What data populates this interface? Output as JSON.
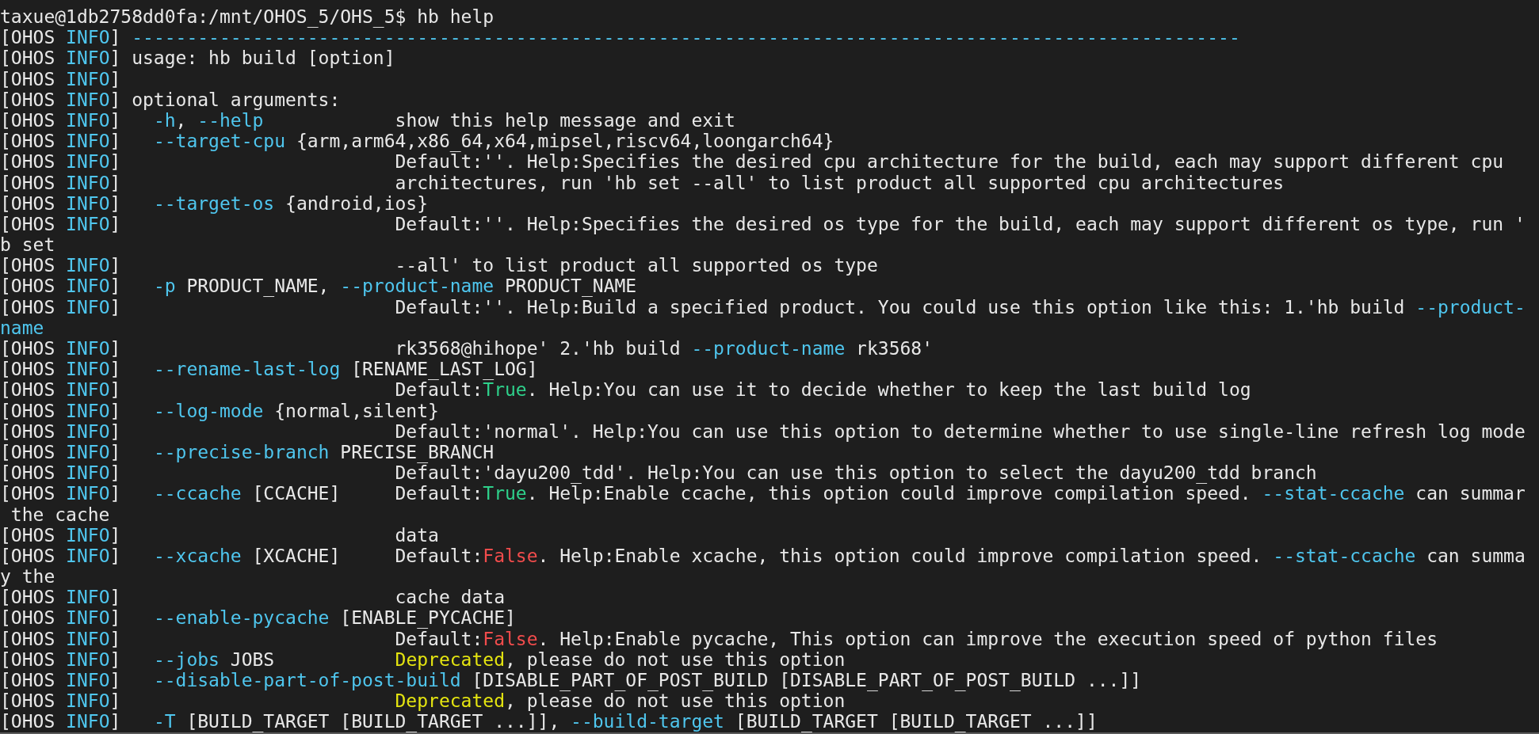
{
  "terminal": {
    "lines": [
      {
        "segments": [
          {
            "text": "taxue@1db2758dd0fa:/mnt/OHOS_5/OHS_5$ hb help",
            "kind": "plain"
          }
        ]
      },
      {
        "segments": [
          {
            "text": "[OHOS ",
            "kind": "plain"
          },
          {
            "text": "INFO",
            "kind": "info"
          },
          {
            "text": "] ",
            "kind": "plain"
          },
          {
            "text": "-----------------------------------------------------------------------------------------------------",
            "kind": "option"
          }
        ]
      },
      {
        "segments": [
          {
            "text": "[OHOS ",
            "kind": "plain"
          },
          {
            "text": "INFO",
            "kind": "info"
          },
          {
            "text": "] usage: hb build [option]",
            "kind": "plain"
          }
        ]
      },
      {
        "segments": [
          {
            "text": "[OHOS ",
            "kind": "plain"
          },
          {
            "text": "INFO",
            "kind": "info"
          },
          {
            "text": "]",
            "kind": "plain"
          }
        ]
      },
      {
        "segments": [
          {
            "text": "[OHOS ",
            "kind": "plain"
          },
          {
            "text": "INFO",
            "kind": "info"
          },
          {
            "text": "] optional arguments:",
            "kind": "plain"
          }
        ]
      },
      {
        "segments": [
          {
            "text": "[OHOS ",
            "kind": "plain"
          },
          {
            "text": "INFO",
            "kind": "info"
          },
          {
            "text": "]   ",
            "kind": "plain"
          },
          {
            "text": "-h",
            "kind": "option"
          },
          {
            "text": ", ",
            "kind": "plain"
          },
          {
            "text": "--help",
            "kind": "option"
          },
          {
            "text": "            show this help message and exit",
            "kind": "plain"
          }
        ]
      },
      {
        "segments": [
          {
            "text": "[OHOS ",
            "kind": "plain"
          },
          {
            "text": "INFO",
            "kind": "info"
          },
          {
            "text": "]   ",
            "kind": "plain"
          },
          {
            "text": "--target-cpu",
            "kind": "option"
          },
          {
            "text": " {arm,arm64,x86_64,x64,mipsel,riscv64,loongarch64}",
            "kind": "plain"
          }
        ]
      },
      {
        "segments": [
          {
            "text": "[OHOS ",
            "kind": "plain"
          },
          {
            "text": "INFO",
            "kind": "info"
          },
          {
            "text": "]                         Default:''. Help:Specifies the desired cpu architecture for the build, each may support different cpu",
            "kind": "plain"
          }
        ]
      },
      {
        "segments": [
          {
            "text": "[OHOS ",
            "kind": "plain"
          },
          {
            "text": "INFO",
            "kind": "info"
          },
          {
            "text": "]                         architectures, run 'hb set --all' to list product all supported cpu architectures",
            "kind": "plain"
          }
        ]
      },
      {
        "segments": [
          {
            "text": "[OHOS ",
            "kind": "plain"
          },
          {
            "text": "INFO",
            "kind": "info"
          },
          {
            "text": "]   ",
            "kind": "plain"
          },
          {
            "text": "--target-os",
            "kind": "option"
          },
          {
            "text": " {android,ios}",
            "kind": "plain"
          }
        ]
      },
      {
        "segments": [
          {
            "text": "[OHOS ",
            "kind": "plain"
          },
          {
            "text": "INFO",
            "kind": "info"
          },
          {
            "text": "]                         Default:''. Help:Specifies the desired os type for the build, each may support different os type, run '",
            "kind": "plain"
          }
        ]
      },
      {
        "segments": [
          {
            "text": "b set",
            "kind": "plain"
          }
        ]
      },
      {
        "segments": [
          {
            "text": "[OHOS ",
            "kind": "plain"
          },
          {
            "text": "INFO",
            "kind": "info"
          },
          {
            "text": "]                         --all' to list product all supported os type",
            "kind": "plain"
          }
        ]
      },
      {
        "segments": [
          {
            "text": "[OHOS ",
            "kind": "plain"
          },
          {
            "text": "INFO",
            "kind": "info"
          },
          {
            "text": "]   ",
            "kind": "plain"
          },
          {
            "text": "-p",
            "kind": "option"
          },
          {
            "text": " PRODUCT_NAME, ",
            "kind": "plain"
          },
          {
            "text": "--product-name",
            "kind": "option"
          },
          {
            "text": " PRODUCT_NAME",
            "kind": "plain"
          }
        ]
      },
      {
        "segments": [
          {
            "text": "[OHOS ",
            "kind": "plain"
          },
          {
            "text": "INFO",
            "kind": "info"
          },
          {
            "text": "]                         Default:''. Help:Build a specified product. You could use this option like this: 1.'hb build ",
            "kind": "plain"
          },
          {
            "text": "--product-",
            "kind": "option"
          }
        ]
      },
      {
        "segments": [
          {
            "text": "name",
            "kind": "option"
          }
        ]
      },
      {
        "segments": [
          {
            "text": "[OHOS ",
            "kind": "plain"
          },
          {
            "text": "INFO",
            "kind": "info"
          },
          {
            "text": "]                         rk3568@hihope' 2.'hb build ",
            "kind": "plain"
          },
          {
            "text": "--product-name",
            "kind": "option"
          },
          {
            "text": " rk3568'",
            "kind": "plain"
          }
        ]
      },
      {
        "segments": [
          {
            "text": "[OHOS ",
            "kind": "plain"
          },
          {
            "text": "INFO",
            "kind": "info"
          },
          {
            "text": "]   ",
            "kind": "plain"
          },
          {
            "text": "--rename-last-log",
            "kind": "option"
          },
          {
            "text": " [RENAME_LAST_LOG]",
            "kind": "plain"
          }
        ]
      },
      {
        "segments": [
          {
            "text": "[OHOS ",
            "kind": "plain"
          },
          {
            "text": "INFO",
            "kind": "info"
          },
          {
            "text": "]                         Default:",
            "kind": "plain"
          },
          {
            "text": "True",
            "kind": "true"
          },
          {
            "text": ". Help:You can use it to decide whether to keep the last build log",
            "kind": "plain"
          }
        ]
      },
      {
        "segments": [
          {
            "text": "[OHOS ",
            "kind": "plain"
          },
          {
            "text": "INFO",
            "kind": "info"
          },
          {
            "text": "]   ",
            "kind": "plain"
          },
          {
            "text": "--log-mode",
            "kind": "option"
          },
          {
            "text": " {normal,silent}",
            "kind": "plain"
          }
        ]
      },
      {
        "segments": [
          {
            "text": "[OHOS ",
            "kind": "plain"
          },
          {
            "text": "INFO",
            "kind": "info"
          },
          {
            "text": "]                         Default:'normal'. Help:You can use this option to determine whether to use single-line refresh log mode",
            "kind": "plain"
          }
        ]
      },
      {
        "segments": [
          {
            "text": "[OHOS ",
            "kind": "plain"
          },
          {
            "text": "INFO",
            "kind": "info"
          },
          {
            "text": "]   ",
            "kind": "plain"
          },
          {
            "text": "--precise-branch",
            "kind": "option"
          },
          {
            "text": " PRECISE_BRANCH",
            "kind": "plain"
          }
        ]
      },
      {
        "segments": [
          {
            "text": "[OHOS ",
            "kind": "plain"
          },
          {
            "text": "INFO",
            "kind": "info"
          },
          {
            "text": "]                         Default:'dayu200_tdd'. Help:You can use this option to select the dayu200_tdd branch",
            "kind": "plain"
          }
        ]
      },
      {
        "segments": [
          {
            "text": "[OHOS ",
            "kind": "plain"
          },
          {
            "text": "INFO",
            "kind": "info"
          },
          {
            "text": "]   ",
            "kind": "plain"
          },
          {
            "text": "--ccache",
            "kind": "option"
          },
          {
            "text": " [CCACHE]     Default:",
            "kind": "plain"
          },
          {
            "text": "True",
            "kind": "true"
          },
          {
            "text": ". Help:Enable ccache, this option could improve compilation speed. ",
            "kind": "plain"
          },
          {
            "text": "--stat-ccache",
            "kind": "option"
          },
          {
            "text": " can summar",
            "kind": "plain"
          }
        ]
      },
      {
        "segments": [
          {
            "text": " the cache",
            "kind": "plain"
          }
        ]
      },
      {
        "segments": [
          {
            "text": "[OHOS ",
            "kind": "plain"
          },
          {
            "text": "INFO",
            "kind": "info"
          },
          {
            "text": "]                         data",
            "kind": "plain"
          }
        ]
      },
      {
        "segments": [
          {
            "text": "[OHOS ",
            "kind": "plain"
          },
          {
            "text": "INFO",
            "kind": "info"
          },
          {
            "text": "]   ",
            "kind": "plain"
          },
          {
            "text": "--xcache",
            "kind": "option"
          },
          {
            "text": " [XCACHE]     Default:",
            "kind": "plain"
          },
          {
            "text": "False",
            "kind": "false"
          },
          {
            "text": ". Help:Enable xcache, this option could improve compilation speed. ",
            "kind": "plain"
          },
          {
            "text": "--stat-ccache",
            "kind": "option"
          },
          {
            "text": " can summa",
            "kind": "plain"
          }
        ]
      },
      {
        "segments": [
          {
            "text": "y the",
            "kind": "plain"
          }
        ]
      },
      {
        "segments": [
          {
            "text": "[OHOS ",
            "kind": "plain"
          },
          {
            "text": "INFO",
            "kind": "info"
          },
          {
            "text": "]                         cache data",
            "kind": "plain"
          }
        ]
      },
      {
        "segments": [
          {
            "text": "[OHOS ",
            "kind": "plain"
          },
          {
            "text": "INFO",
            "kind": "info"
          },
          {
            "text": "]   ",
            "kind": "plain"
          },
          {
            "text": "--enable-pycache",
            "kind": "option"
          },
          {
            "text": " [ENABLE_PYCACHE]",
            "kind": "plain"
          }
        ]
      },
      {
        "segments": [
          {
            "text": "[OHOS ",
            "kind": "plain"
          },
          {
            "text": "INFO",
            "kind": "info"
          },
          {
            "text": "]                         Default:",
            "kind": "plain"
          },
          {
            "text": "False",
            "kind": "false"
          },
          {
            "text": ". Help:Enable pycache, This option can improve the execution speed of python files",
            "kind": "plain"
          }
        ]
      },
      {
        "segments": [
          {
            "text": "[OHOS ",
            "kind": "plain"
          },
          {
            "text": "INFO",
            "kind": "info"
          },
          {
            "text": "]   ",
            "kind": "plain"
          },
          {
            "text": "--jobs",
            "kind": "option"
          },
          {
            "text": " JOBS           ",
            "kind": "plain"
          },
          {
            "text": "Deprecated",
            "kind": "deprecated"
          },
          {
            "text": ", please do not use this option",
            "kind": "plain"
          }
        ]
      },
      {
        "segments": [
          {
            "text": "[OHOS ",
            "kind": "plain"
          },
          {
            "text": "INFO",
            "kind": "info"
          },
          {
            "text": "]   ",
            "kind": "plain"
          },
          {
            "text": "--disable-part-of-post-build",
            "kind": "option"
          },
          {
            "text": " [DISABLE_PART_OF_POST_BUILD [DISABLE_PART_OF_POST_BUILD ...]]",
            "kind": "plain"
          }
        ]
      },
      {
        "segments": [
          {
            "text": "[OHOS ",
            "kind": "plain"
          },
          {
            "text": "INFO",
            "kind": "info"
          },
          {
            "text": "]                         ",
            "kind": "plain"
          },
          {
            "text": "Deprecated",
            "kind": "deprecated"
          },
          {
            "text": ", please do not use this option",
            "kind": "plain"
          }
        ]
      },
      {
        "segments": [
          {
            "text": "[OHOS ",
            "kind": "plain"
          },
          {
            "text": "INFO",
            "kind": "info"
          },
          {
            "text": "]   ",
            "kind": "plain"
          },
          {
            "text": "-T",
            "kind": "option"
          },
          {
            "text": " [BUILD_TARGET [BUILD_TARGET ...]], ",
            "kind": "plain"
          },
          {
            "text": "--build-target",
            "kind": "option"
          },
          {
            "text": " [BUILD_TARGET [BUILD_TARGET ...]]",
            "kind": "plain"
          }
        ]
      }
    ]
  }
}
